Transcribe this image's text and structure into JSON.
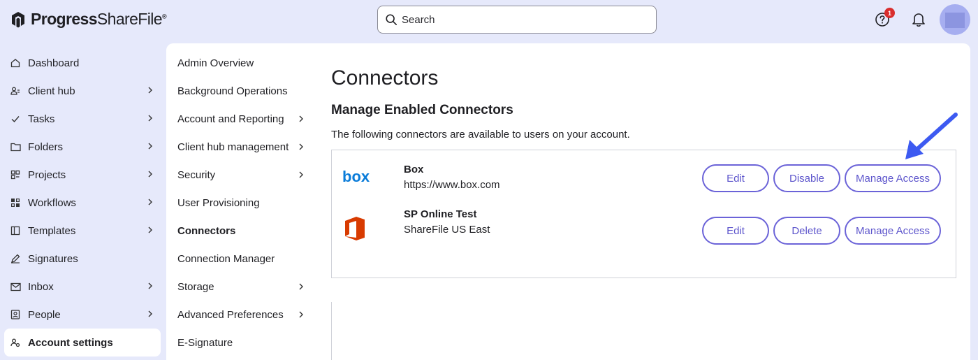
{
  "app": {
    "brand_bold": "Progress",
    "brand_light": "ShareFile",
    "brand_tm": "®"
  },
  "search": {
    "placeholder": "Search"
  },
  "header": {
    "notification_count": "1"
  },
  "sidebar": {
    "items": [
      {
        "label": "Dashboard",
        "icon": "home-icon",
        "has_chevron": false
      },
      {
        "label": "Client hub",
        "icon": "client-hub-icon",
        "has_chevron": true
      },
      {
        "label": "Tasks",
        "icon": "check-icon",
        "has_chevron": true
      },
      {
        "label": "Folders",
        "icon": "folder-icon",
        "has_chevron": true
      },
      {
        "label": "Projects",
        "icon": "projects-icon",
        "has_chevron": true
      },
      {
        "label": "Workflows",
        "icon": "workflow-icon",
        "has_chevron": true
      },
      {
        "label": "Templates",
        "icon": "templates-icon",
        "has_chevron": true
      },
      {
        "label": "Signatures",
        "icon": "pen-icon",
        "has_chevron": false
      },
      {
        "label": "Inbox",
        "icon": "mail-icon",
        "has_chevron": true
      },
      {
        "label": "People",
        "icon": "people-icon",
        "has_chevron": true
      },
      {
        "label": "Account settings",
        "icon": "settings-icon",
        "has_chevron": false,
        "active": true
      }
    ]
  },
  "subnav": {
    "items": [
      {
        "label": "Admin Overview",
        "has_chevron": false
      },
      {
        "label": "Background Operations",
        "has_chevron": false
      },
      {
        "label": "Account and Reporting",
        "has_chevron": true
      },
      {
        "label": "Client hub management",
        "has_chevron": true
      },
      {
        "label": "Security",
        "has_chevron": true
      },
      {
        "label": "User Provisioning",
        "has_chevron": false
      },
      {
        "label": "Connectors",
        "has_chevron": false,
        "active": true
      },
      {
        "label": "Connection Manager",
        "has_chevron": false
      },
      {
        "label": "Storage",
        "has_chevron": true
      },
      {
        "label": "Advanced Preferences",
        "has_chevron": true
      },
      {
        "label": "E-Signature",
        "has_chevron": false
      }
    ]
  },
  "main": {
    "title": "Connectors",
    "section_title": "Manage Enabled Connectors",
    "description": "The following connectors are available to users on your account.",
    "connectors": [
      {
        "logo_text": "box",
        "logo_color": "#0061d5",
        "name": "Box",
        "detail": "https://www.box.com",
        "buttons": [
          "Edit",
          "Disable",
          "Manage Access"
        ]
      },
      {
        "logo_icon": "office-icon",
        "logo_color": "#d83b01",
        "name": "SP Online Test",
        "detail": "ShareFile US East",
        "buttons": [
          "Edit",
          "Delete",
          "Manage Access"
        ]
      }
    ]
  },
  "colors": {
    "background": "#e6e9fb",
    "accent": "#6b63d8",
    "annotation_arrow": "#3d5af1",
    "badge": "#d92d2d"
  }
}
